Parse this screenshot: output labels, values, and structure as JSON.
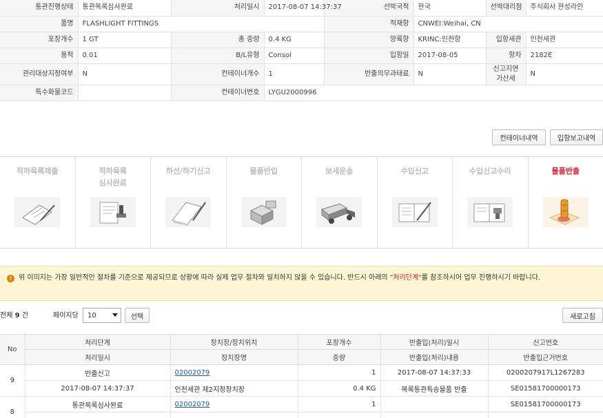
{
  "info": {
    "rows": [
      [
        [
          "통관진행상태",
          "통관목록심사완료"
        ],
        [
          "처리일시",
          "2017-08-07 14:37:37"
        ],
        [
          "선박국적",
          "한국"
        ],
        [
          "선박대리점",
          "주식회사 한성라인"
        ]
      ],
      [
        [
          "품명",
          "FLASHLIGHT FITTINGS"
        ],
        [
          "적재항",
          "CNWEI:Weihai, CN"
        ]
      ],
      [
        [
          "포장개수",
          "1 GT"
        ],
        [
          "총 중량",
          "0.4 KG"
        ],
        [
          "양륙항",
          "KRINC:인천항"
        ],
        [
          "입항세관",
          "인천세관"
        ]
      ],
      [
        [
          "용적",
          "0.01"
        ],
        [
          "B/L유형",
          "Consol"
        ],
        [
          "입항일",
          "2017-08-05"
        ],
        [
          "항차",
          "2182E"
        ]
      ],
      [
        [
          "관리대상지정여부",
          "N"
        ],
        [
          "컨테이너개수",
          "1"
        ],
        [
          "반출의무과태료",
          "N"
        ],
        [
          "신고지연가산세",
          "N"
        ]
      ],
      [
        [
          "특수화물코드",
          ""
        ],
        [
          "컨테이너번호",
          "LYGU2000996"
        ]
      ]
    ]
  },
  "buttons": {
    "container_list": "컨테이너내역",
    "arrival_report": "입항보고내역",
    "select": "선택",
    "refresh": "새로고침"
  },
  "steps": [
    {
      "label": "적하목록제출",
      "icon": "clipboard-icon"
    },
    {
      "label": "적하목록\n심사완료",
      "icon": "stamp-document-icon"
    },
    {
      "label": "하선/하기신고",
      "icon": "book-pen-icon"
    },
    {
      "label": "물품반입",
      "icon": "boxes-icon"
    },
    {
      "label": "보세운송",
      "icon": "truck-icon"
    },
    {
      "label": "수입신고",
      "icon": "open-book-icon"
    },
    {
      "label": "수입신고수리",
      "icon": "approved-book-icon"
    },
    {
      "label": "물품반출",
      "icon": "seal-stamp-icon"
    }
  ],
  "notice": {
    "text_before": "위 이미지는 가장 일반적인 절차를 기준으로 제공되므로 상황에 따라 실제 업무 절차와 일치하지 않을 수 있습니다. 반드시 아래의 ",
    "highlight": "\"처리단계\"",
    "text_after": "를 참조하시어 업무 진행하시기 바랍니다."
  },
  "list": {
    "total_prefix": "전체 ",
    "total_count": "9",
    "total_suffix": " 건",
    "per_page_label": "페이지당",
    "per_page_value": "10"
  },
  "grid": {
    "no_header": "No",
    "header_row1": [
      "처리단계",
      "장치장/장치위치",
      "포장개수",
      "반출입(처리)일시",
      "신고번호"
    ],
    "header_row2": [
      "처리일시",
      "장치장명",
      "중량",
      "반출입(처리)내용",
      "반출입근거번호"
    ],
    "records": [
      {
        "no": "9",
        "row1": [
          "반출신고",
          "02002079",
          "1",
          "2017-08-07 14:37:33",
          "0200207917L1267283"
        ],
        "row2": [
          "2017-08-07 14:37:37",
          "인천세관 제2지정장치장",
          "0.4 KG",
          "목록통관특송물품 반출",
          "SE01581700000173"
        ]
      },
      {
        "no": "8",
        "row1": [
          "통관목록심사완료",
          "02002079",
          "1",
          "",
          "SE01581700000173"
        ]
      }
    ]
  }
}
